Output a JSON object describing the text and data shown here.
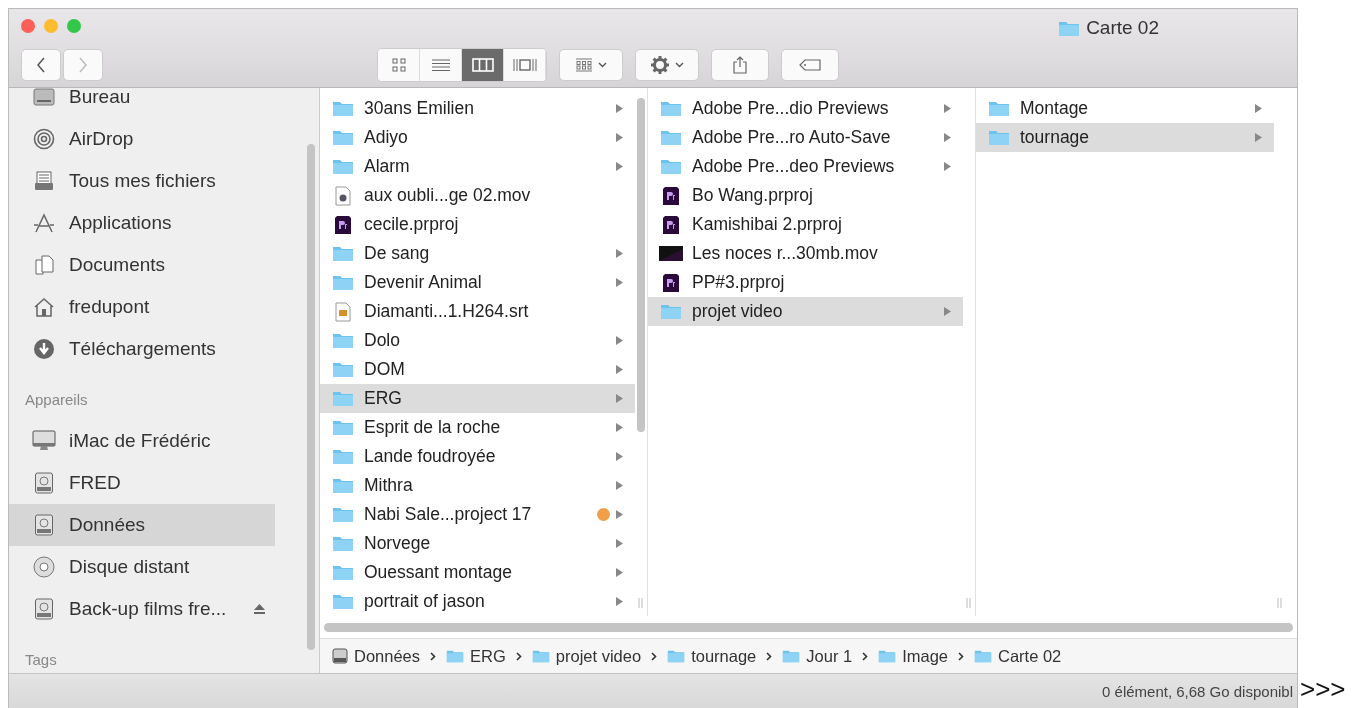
{
  "window": {
    "title": "Carte 02"
  },
  "toolbar": {
    "view_modes": [
      {
        "kind": "icons",
        "selected": false
      },
      {
        "kind": "list",
        "selected": false
      },
      {
        "kind": "columns",
        "selected": true
      },
      {
        "kind": "coverflow",
        "selected": false
      }
    ]
  },
  "sidebar": {
    "items": [
      {
        "kind": "desktop",
        "label": "Bureau",
        "selected": false
      },
      {
        "kind": "airdrop",
        "label": "AirDrop",
        "selected": false
      },
      {
        "kind": "allfiles",
        "label": "Tous mes fichiers",
        "selected": false
      },
      {
        "kind": "apps",
        "label": "Applications",
        "selected": false
      },
      {
        "kind": "docs",
        "label": "Documents",
        "selected": false
      },
      {
        "kind": "home",
        "label": "fredupont",
        "selected": false
      },
      {
        "kind": "download",
        "label": "Téléchargements",
        "selected": false
      },
      {
        "kind": "heading",
        "label": "Appareils"
      },
      {
        "kind": "imac",
        "label": "iMac de Frédéric",
        "selected": false
      },
      {
        "kind": "disk",
        "label": "FRED",
        "selected": false
      },
      {
        "kind": "disk",
        "label": "Données",
        "selected": true
      },
      {
        "kind": "remote",
        "label": "Disque distant",
        "selected": false
      },
      {
        "kind": "disk",
        "label": "Back-up films fre...",
        "selected": false,
        "ejectable": true
      },
      {
        "kind": "heading",
        "label": "Tags"
      }
    ]
  },
  "columns": [
    {
      "items": [
        {
          "kind": "folder",
          "name": "30ans Emilien",
          "selected": false
        },
        {
          "kind": "folder",
          "name": "Adiyo",
          "selected": false
        },
        {
          "kind": "folder",
          "name": "Alarm",
          "selected": false
        },
        {
          "kind": "movie",
          "name": "aux oubli...ge 02.mov",
          "selected": false
        },
        {
          "kind": "premiere",
          "name": "cecile.prproj",
          "selected": false
        },
        {
          "kind": "folder",
          "name": "De sang",
          "selected": false
        },
        {
          "kind": "folder",
          "name": "Devenir Animal",
          "selected": false
        },
        {
          "kind": "subtitle",
          "name": "Diamanti...1.H264.srt",
          "selected": false
        },
        {
          "kind": "folder",
          "name": "Dolo",
          "selected": false
        },
        {
          "kind": "folder",
          "name": "DOM",
          "selected": false
        },
        {
          "kind": "folder",
          "name": "ERG",
          "selected": true
        },
        {
          "kind": "folder",
          "name": "Esprit de la roche",
          "selected": false
        },
        {
          "kind": "folder",
          "name": "Lande foudroyée",
          "selected": false
        },
        {
          "kind": "folder",
          "name": "Mithra",
          "selected": false
        },
        {
          "kind": "folder",
          "name": "Nabi Sale...project 17",
          "selected": false,
          "color": "#f0a048"
        },
        {
          "kind": "folder",
          "name": "Norvege",
          "selected": false
        },
        {
          "kind": "folder",
          "name": "Ouessant montage",
          "selected": false
        },
        {
          "kind": "folder",
          "name": "portrait of jason",
          "selected": false
        }
      ]
    },
    {
      "items": [
        {
          "kind": "folder",
          "name": "Adobe Pre...dio Previews",
          "selected": false
        },
        {
          "kind": "folder",
          "name": "Adobe Pre...ro Auto-Save",
          "selected": false
        },
        {
          "kind": "folder",
          "name": "Adobe Pre...deo Previews",
          "selected": false
        },
        {
          "kind": "premiere",
          "name": "Bo Wang.prproj",
          "selected": false
        },
        {
          "kind": "premiere",
          "name": "Kamishibai 2.prproj",
          "selected": false
        },
        {
          "kind": "video",
          "name": "Les noces r...30mb.mov",
          "selected": false
        },
        {
          "kind": "premiere",
          "name": "PP#3.prproj",
          "selected": false
        },
        {
          "kind": "folder",
          "name": "projet video",
          "selected": true
        }
      ]
    },
    {
      "items": [
        {
          "kind": "folder",
          "name": "Montage",
          "selected": false
        },
        {
          "kind": "folder",
          "name": "tournage",
          "selected": true
        }
      ]
    }
  ],
  "path_bar": [
    {
      "kind": "disk",
      "label": "Données"
    },
    {
      "kind": "folder",
      "label": "ERG"
    },
    {
      "kind": "folder",
      "label": "projet video"
    },
    {
      "kind": "folder",
      "label": "tournage"
    },
    {
      "kind": "folder",
      "label": "Jour 1"
    },
    {
      "kind": "folder",
      "label": "Image"
    },
    {
      "kind": "folder",
      "label": "Carte 02"
    }
  ],
  "status_bar": "0 élément, 6,68 Go disponibl",
  "overlay_text": ">>>"
}
